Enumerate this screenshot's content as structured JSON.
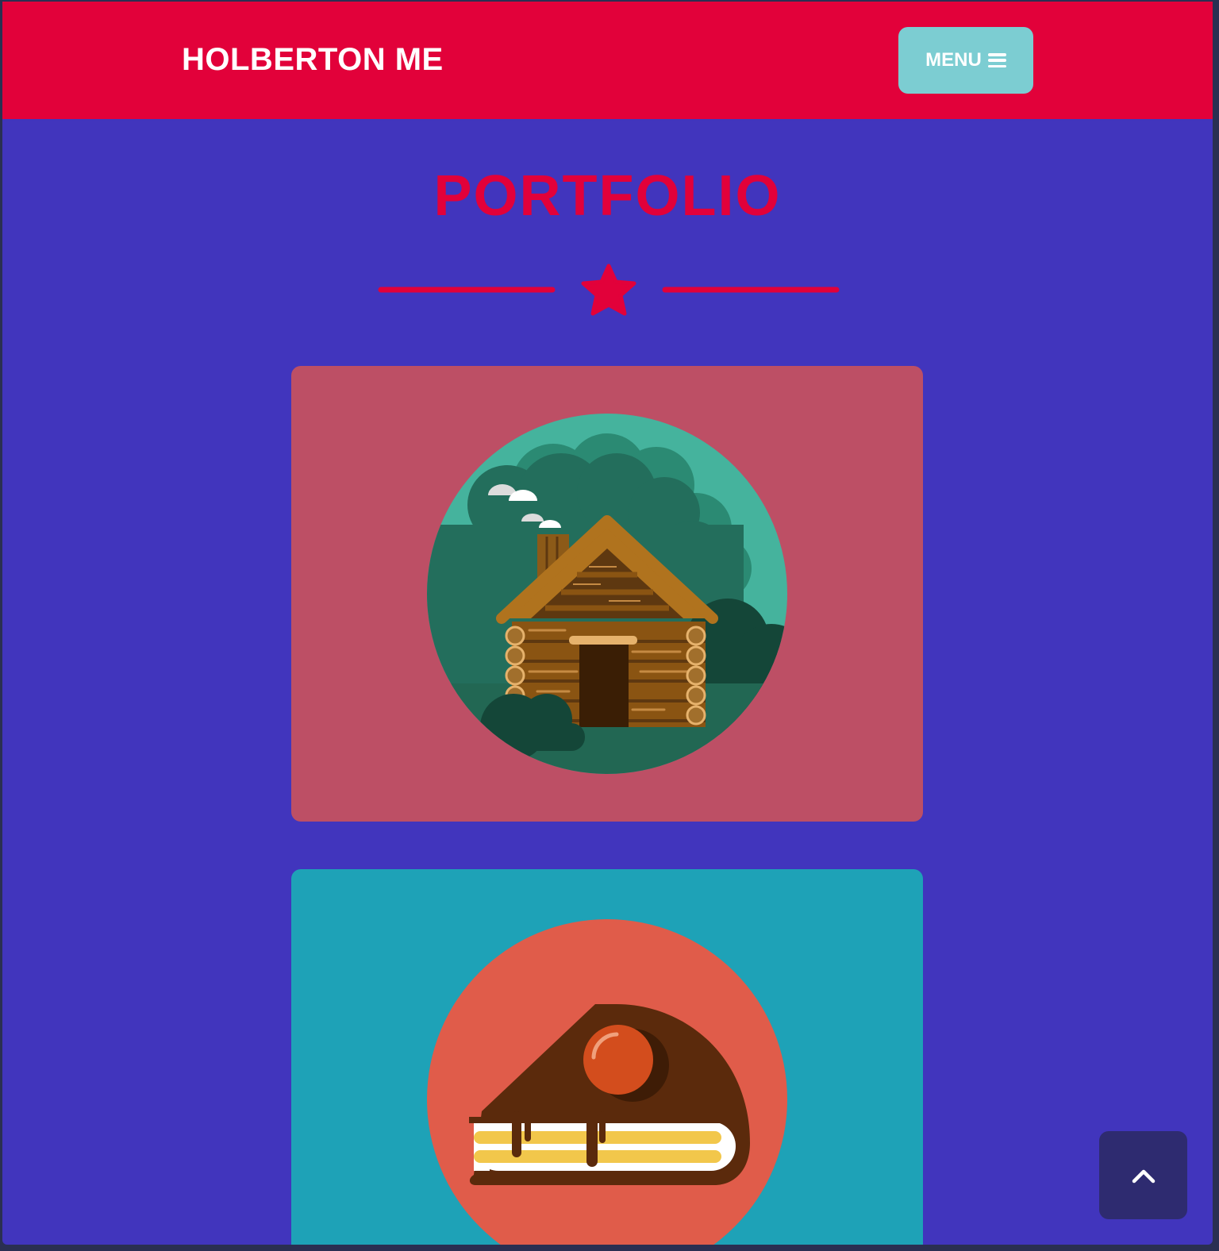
{
  "navbar": {
    "brand": "HOLBERTON ME",
    "menu_label": "MENU",
    "menu_icon": "hamburger-icon"
  },
  "portfolio": {
    "title": "PORTFOLIO",
    "divider_icon": "star-icon",
    "items": [
      {
        "image": "log-cabin-illustration",
        "background": "#bd4f65"
      },
      {
        "image": "cake-slice-illustration",
        "background": "#1ea2b7"
      }
    ]
  },
  "scroll_top": {
    "icon": "chevron-up-icon"
  },
  "colors": {
    "primary_red": "#e2013a",
    "page_background": "#4135bd",
    "menu_button": "#7ccdd2",
    "scroll_button": "#2e2b70"
  }
}
